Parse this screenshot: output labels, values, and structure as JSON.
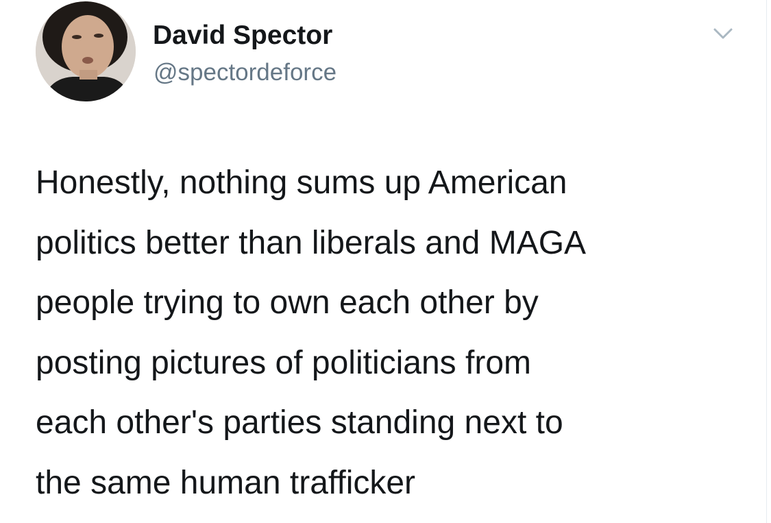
{
  "user": {
    "display_name": "David Spector",
    "handle": "@spectordeforce",
    "avatar_icon": "profile-photo"
  },
  "tweet": {
    "lines": [
      "Honestly, nothing sums up American",
      "politics better than liberals and MAGA",
      "people trying to own each other by",
      "posting pictures of politicians from",
      "each other's parties standing next to",
      "the same human trafficker"
    ]
  },
  "icons": {
    "more_menu": "chevron-down-icon"
  },
  "colors": {
    "text": "#14171a",
    "secondary_text": "#657786",
    "caret": "#aab8c2",
    "background": "#ffffff"
  }
}
